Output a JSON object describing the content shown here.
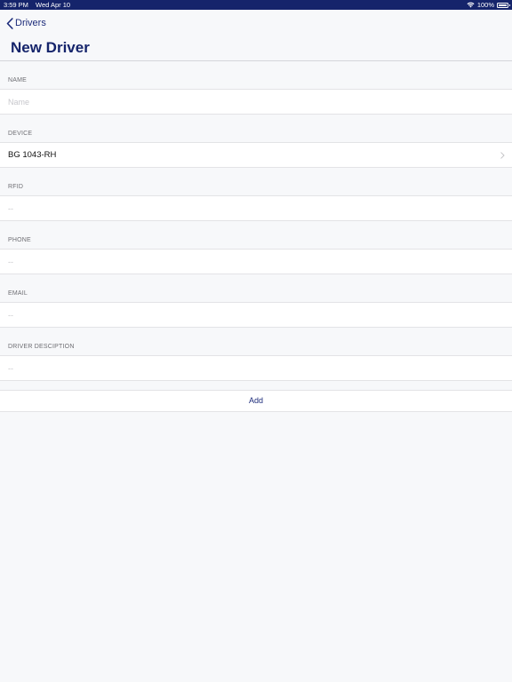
{
  "status_bar": {
    "time": "3:59 PM",
    "date": "Wed Apr 10",
    "battery": "100%",
    "icons": [
      "wifi-icon",
      "battery-icon"
    ]
  },
  "nav": {
    "back_label": "Drivers",
    "title": "New Driver"
  },
  "form": {
    "name": {
      "label": "NAME",
      "placeholder": "Name",
      "value": ""
    },
    "device": {
      "label": "DEVICE",
      "value": "BG 1043-RH"
    },
    "rfid": {
      "label": "RFID",
      "placeholder": "--",
      "value": ""
    },
    "phone": {
      "label": "PHONE",
      "placeholder": "--",
      "value": ""
    },
    "email": {
      "label": "EMAIL",
      "placeholder": "--",
      "value": ""
    },
    "description": {
      "label": "DRIVER DESCIPTION",
      "placeholder": "--",
      "value": ""
    },
    "add_label": "Add"
  },
  "colors": {
    "status_bar": "#15246b",
    "accent": "#1c2b7a",
    "background": "#f7f8fa"
  }
}
